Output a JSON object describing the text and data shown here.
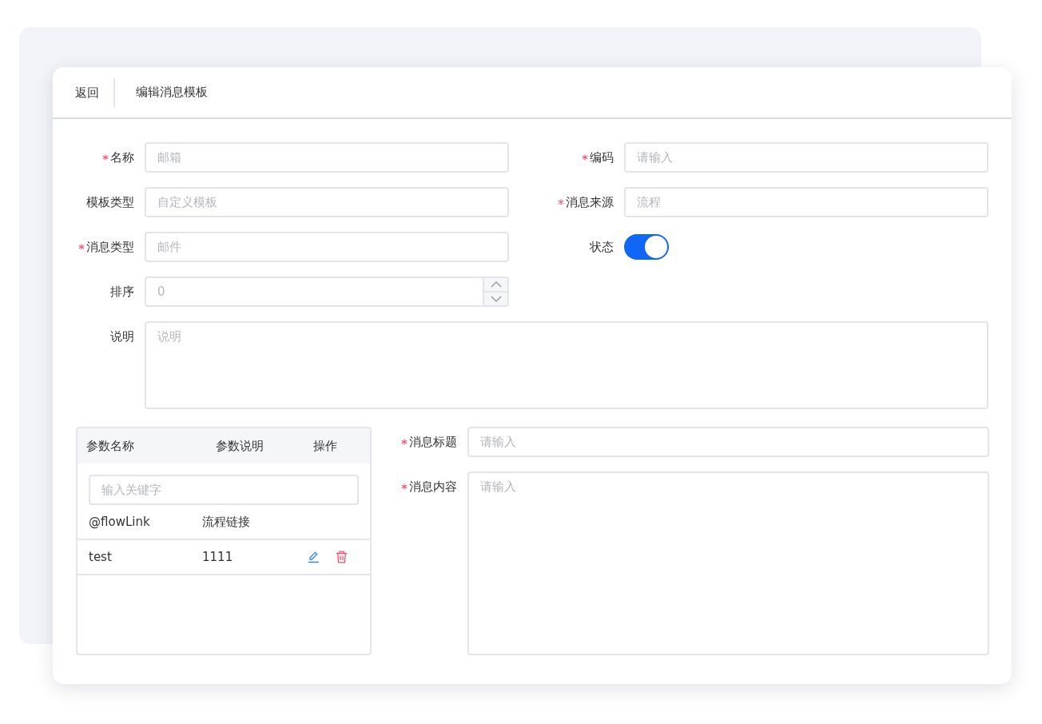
{
  "header": {
    "back": "返回",
    "title": "编辑消息模板"
  },
  "fields": [
    {
      "kind": "text",
      "label": "名称",
      "required": true,
      "placeholder": "邮箱"
    },
    {
      "kind": "text",
      "label": "编码",
      "required": true,
      "placeholder": "请输入"
    },
    {
      "kind": "text",
      "label": "模板类型",
      "required": false,
      "placeholder": "自定义模板"
    },
    {
      "kind": "text",
      "label": "消息来源",
      "required": true,
      "placeholder": "流程"
    },
    {
      "kind": "text",
      "label": "消息类型",
      "required": true,
      "placeholder": "邮件"
    },
    {
      "kind": "toggle",
      "label": "状态",
      "required": false,
      "on": true
    },
    {
      "kind": "number",
      "label": "排序",
      "required": false,
      "placeholder": "0"
    },
    {
      "kind": "textarea",
      "label": "说明",
      "required": false,
      "placeholder": "说明"
    }
  ],
  "params": {
    "columns": [
      "参数名称",
      "参数说明",
      "操作"
    ],
    "search": {
      "placeholder": "输入关键字"
    },
    "rows": [
      {
        "name": "@flowLink",
        "description": "流程链接",
        "editable": false
      },
      {
        "name": "test",
        "description": "1111",
        "editable": true
      }
    ]
  },
  "message": [
    {
      "kind": "text",
      "label": "消息标题",
      "required": true,
      "placeholder": "请输入"
    },
    {
      "kind": "textarea",
      "label": "消息内容",
      "required": true,
      "placeholder": "请输入"
    }
  ]
}
